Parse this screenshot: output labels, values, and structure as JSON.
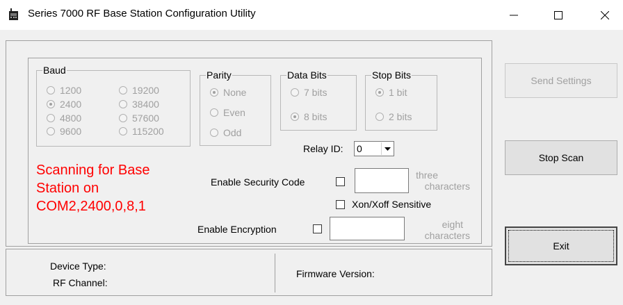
{
  "window": {
    "title": "Series 7000 RF Base Station Configuration Utility",
    "icons": {
      "app": "radio-device-icon",
      "minimize": "minimize-icon",
      "maximize": "maximize-icon",
      "close": "close-icon"
    }
  },
  "baud": {
    "legend": "Baud",
    "options": [
      "1200",
      "2400",
      "4800",
      "9600",
      "19200",
      "38400",
      "57600",
      "115200"
    ],
    "selected": "2400"
  },
  "parity": {
    "legend": "Parity",
    "options": [
      "None",
      "Even",
      "Odd"
    ],
    "selected": "None"
  },
  "data_bits": {
    "legend": "Data Bits",
    "options": [
      "7 bits",
      "8 bits"
    ],
    "selected": "8 bits"
  },
  "stop_bits": {
    "legend": "Stop Bits",
    "options": [
      "1 bit",
      "2 bits"
    ],
    "selected": "1 bit"
  },
  "relay": {
    "label": "Relay ID:",
    "value": "0"
  },
  "status": {
    "line1": "Scanning for Base",
    "line2": "Station on",
    "line3": "COM2,2400,0,8,1",
    "color": "#ff0000"
  },
  "security": {
    "label": "Enable Security Code",
    "checked": false,
    "value": "",
    "hint_line1": "three",
    "hint_line2": "characters"
  },
  "xon": {
    "label": "Xon/Xoff Sensitive",
    "checked": false
  },
  "encryption": {
    "label": "Enable Encryption",
    "checked": false,
    "value": "",
    "hint_line1": "eight",
    "hint_line2": "characters"
  },
  "buttons": {
    "send": "Send Settings",
    "stop": "Stop Scan",
    "exit": "Exit"
  },
  "footer": {
    "device_type_label": "Device Type:",
    "rf_channel_label": "RF Channel:",
    "firmware_label": "Firmware Version:"
  }
}
